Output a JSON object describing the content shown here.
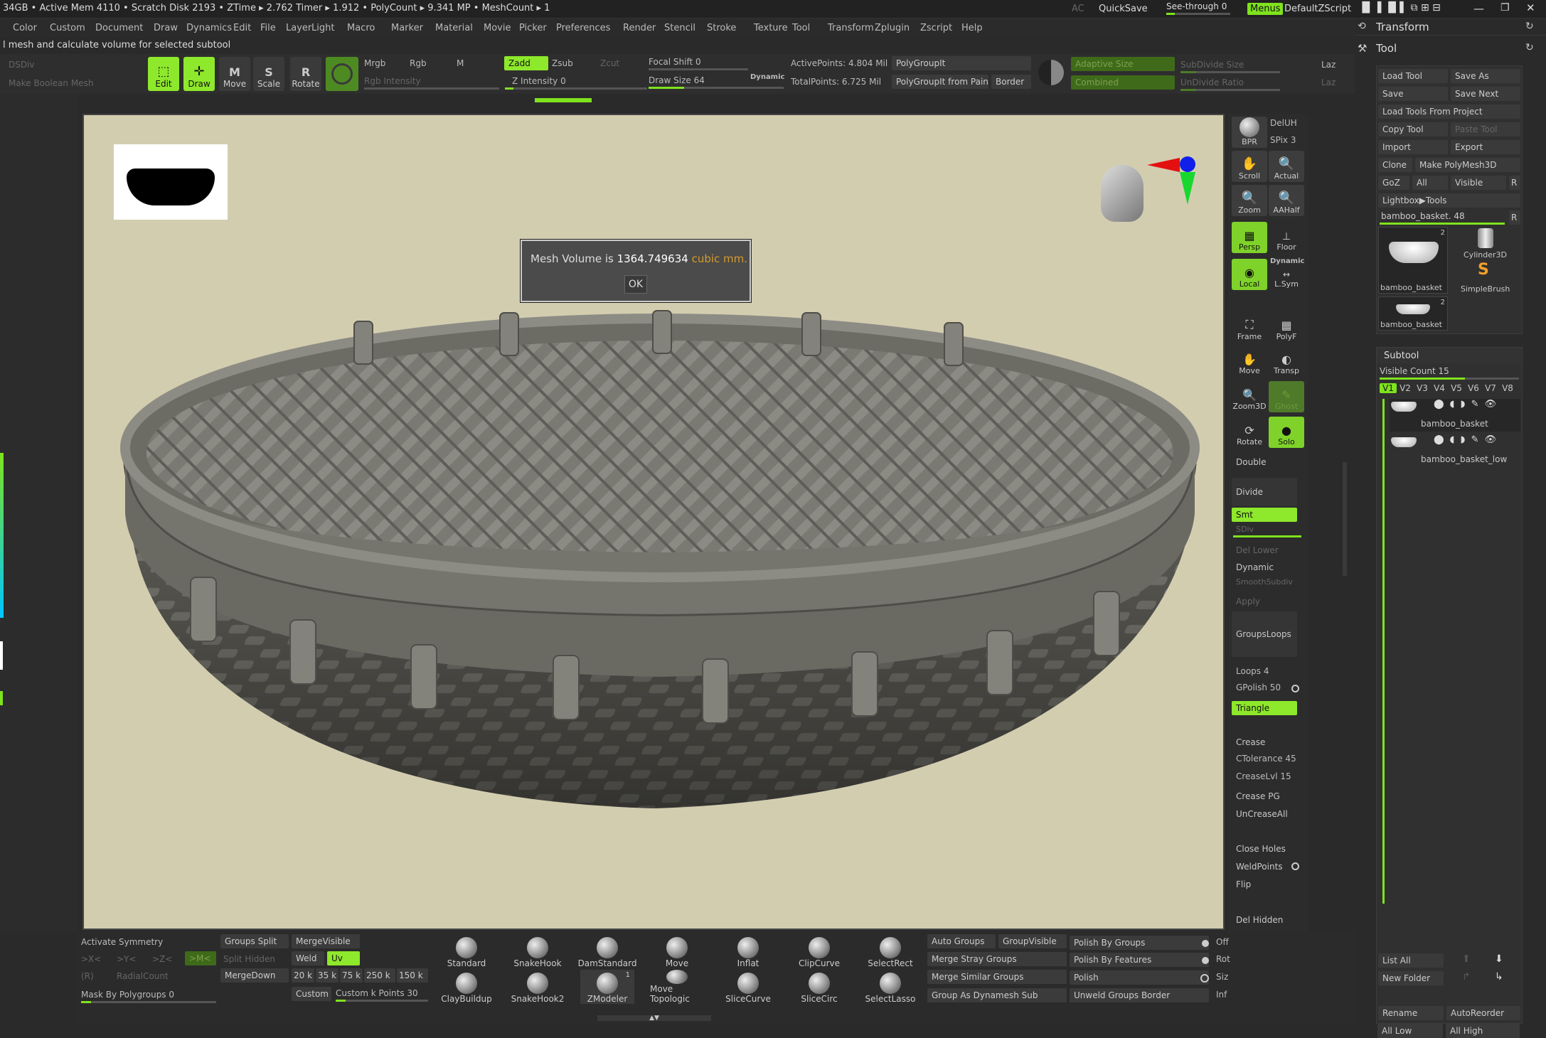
{
  "status": {
    "text": "34GB • Active Mem 4110 • Scratch Disk 2193 • ZTime ▸ 2.762 Timer ▸ 1.912 • PolyCount ▸ 9.341 MP • MeshCount ▸ 1",
    "ac": "AC",
    "quicksave": "QuickSave",
    "seethrough": "See-through",
    "seethrough_val": "0",
    "menus": "Menus",
    "script": "DefaultZScript"
  },
  "menu": [
    "Color",
    "Custom",
    "Document",
    "Draw",
    "Dynamics",
    "Edit",
    "File",
    "Layer",
    "Light",
    "Macro",
    "Marker",
    "Material",
    "Movie",
    "Picker",
    "Preferences",
    "Render",
    "Stencil",
    "Stroke",
    "Texture",
    "Tool",
    "Transform",
    "Zplugin",
    "Zscript",
    "Help"
  ],
  "notice": "l mesh and calculate volume for selected subtool",
  "left_top": {
    "dsdiv": "DSDiv",
    "boolean": "Make Boolean Mesh"
  },
  "tools": {
    "edit": "Edit",
    "draw": "Draw",
    "move": "Move",
    "scale": "Scale",
    "rotate": "Rotate"
  },
  "toolbar": {
    "mrgb": "Mrgb",
    "rgb": "Rgb",
    "m": "M",
    "rgb_int": "Rgb Intensity",
    "zadd": "Zadd",
    "zsub": "Zsub",
    "zcut": "Zcut",
    "z_int": "Z Intensity 0",
    "focal": "Focal Shift 0",
    "draw_size": "Draw Size 64",
    "dynamic": "Dynamic",
    "active_pts": "ActivePoints: 4.804 Mil",
    "total_pts": "TotalPoints: 6.725 Mil",
    "polygroupit": "PolyGroupIt",
    "pg_from_paint": "PolyGroupIt from Pain",
    "border": "Border",
    "adaptive": "Adaptive Size",
    "combined": "Combined",
    "subdiv_size": "SubDivide Size",
    "undiv_ratio": "UnDivide Ratio",
    "laz1": "Laz",
    "laz2": "Laz"
  },
  "dialog": {
    "label": "Mesh Volume is",
    "value": "1364.749634",
    "unit": "cubic mm.",
    "ok": "OK"
  },
  "right_shelf": {
    "bpr": "BPR",
    "spix": "SPix 3",
    "deluh": "DelUH",
    "scroll": "Scroll",
    "actual": "Actual",
    "zoom": "Zoom",
    "aahalf": "AAHalf",
    "persp": "Persp",
    "floor": "Floor",
    "local": "Local",
    "lsym": "L.Sym",
    "dynamic": "Dynamic",
    "frame": "Frame",
    "polyf": "PolyF",
    "move": "Move",
    "transp": "Transp",
    "zoom3d": "Zoom3D",
    "ghost": "Ghost",
    "rotate": "Rotate",
    "solo": "Solo",
    "double": "Double",
    "divide": "Divide",
    "smt": "Smt",
    "sdiv": "SDiv",
    "del_lower": "Del Lower",
    "dyn2": "Dynamic",
    "smoothsubdiv": "SmoothSubdiv",
    "apply": "Apply",
    "groupsloops": "GroupsLoops",
    "loops": "Loops 4",
    "gpolish": "GPolish 50",
    "triangle": "Triangle",
    "crease": "Crease",
    "ctol": "CTolerance 45",
    "creaselvl": "CreaseLvl 15",
    "creasepg": "Crease PG",
    "uncrease": "UnCreaseAll",
    "closeholes": "Close Holes",
    "weldpoints": "WeldPoints",
    "flip": "Flip",
    "delhidden": "Del Hidden"
  },
  "tray": {
    "transform": "Transform",
    "tool": "Tool",
    "load_tool": "Load Tool",
    "save_as": "Save As",
    "save": "Save",
    "save_next": "Save Next",
    "load_from_project": "Load Tools From Project",
    "copy_tool": "Copy Tool",
    "paste_tool": "Paste Tool",
    "import": "Import",
    "export": "Export",
    "clone": "Clone",
    "make_polymesh": "Make PolyMesh3D",
    "goz": "GoZ",
    "all": "All",
    "visible": "Visible",
    "r": "R",
    "lightbox": "Lightbox▶Tools",
    "current_tool": "bamboo_basket. 48",
    "thumbs": [
      {
        "name": "bamboo_basket",
        "badge": "2"
      },
      {
        "name": "Cylinder3D",
        "badge": ""
      },
      {
        "name": "SimpleBrush",
        "badge": ""
      },
      {
        "name": "bamboo_basket",
        "badge": "2"
      }
    ],
    "subtool": "Subtool",
    "visible_count": "Visible Count 15",
    "versions": [
      "V1",
      "V2",
      "V3",
      "V4",
      "V5",
      "V6",
      "V7",
      "V8"
    ],
    "subtools": [
      "bamboo_basket",
      "bamboo_basket_low"
    ],
    "list_all": "List All",
    "new_folder": "New Folder",
    "rename": "Rename",
    "autoreorder": "AutoReorder",
    "all_low": "All Low",
    "all_high": "All High"
  },
  "bottom": {
    "activate_sym": "Activate Symmetry",
    "x": ">X<",
    "y": ">Y<",
    "z": ">Z<",
    "m": ">M<",
    "r": "(R)",
    "radial": "RadialCount",
    "mask_pg": "Mask By Polygroups 0",
    "groups_split": "Groups Split",
    "split_hidden": "Split Hidden",
    "weld": "Weld",
    "uv": "Uv",
    "merge_visible": "MergeVisible",
    "merge_down": "MergeDown",
    "k20": "20 k",
    "k35": "35 k",
    "k75": "75 k",
    "k250": "250 k",
    "k150": "150 k",
    "custom": "Custom",
    "custom_pts": "Custom k Points 30",
    "brushes": [
      "Standard",
      "SnakeHook",
      "DamStandard",
      "Move",
      "Inflat",
      "ClipCurve",
      "SelectRect",
      "ClayBuildup",
      "SnakeHook2",
      "ZModeler",
      "Move Topologic",
      "SliceCurve",
      "SliceCirc",
      "SelectLasso"
    ],
    "zmodeler_badge": "1",
    "auto_groups": "Auto Groups",
    "group_visible": "GroupVisible",
    "merge_stray": "Merge Stray Groups",
    "merge_similar": "Merge Similar Groups",
    "group_dyn": "Group As Dynamesh Sub",
    "polish_groups": "Polish By Groups",
    "polish_features": "Polish By Features",
    "polish": "Polish",
    "unweld": "Unweld Groups Border",
    "off": "Off",
    "rot": "Rot",
    "siz": "Siz",
    "inf": "Inf"
  },
  "colors": {
    "accent": "#8ee82b",
    "canvas": "#d3cdb0",
    "unit": "#d79a2c"
  }
}
